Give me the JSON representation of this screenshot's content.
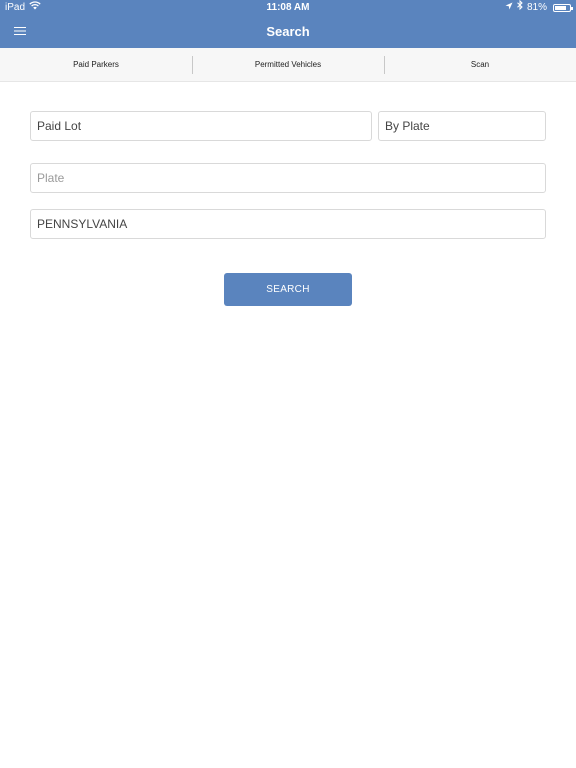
{
  "status_bar": {
    "carrier": "iPad",
    "time": "11:08 AM",
    "battery_percent_label": "81%",
    "battery_level": 0.81,
    "icons": [
      "wifi-icon",
      "location-arrow-icon",
      "bluetooth-icon",
      "battery-icon"
    ]
  },
  "nav": {
    "title": "Search",
    "menu_icon": "hamburger-menu-icon"
  },
  "tabs": [
    {
      "label": "Paid Parkers"
    },
    {
      "label": "Permitted Vehicles"
    },
    {
      "label": "Scan"
    }
  ],
  "form": {
    "lot_value": "Paid Lot",
    "mode_value": "By Plate",
    "plate_placeholder": "Plate",
    "plate_value": "",
    "state_value": "PENNSYLVANIA",
    "search_label": "SEARCH"
  },
  "colors": {
    "header": "#5a84be",
    "button": "#5a84be",
    "tab_background": "#f7f7f7"
  }
}
